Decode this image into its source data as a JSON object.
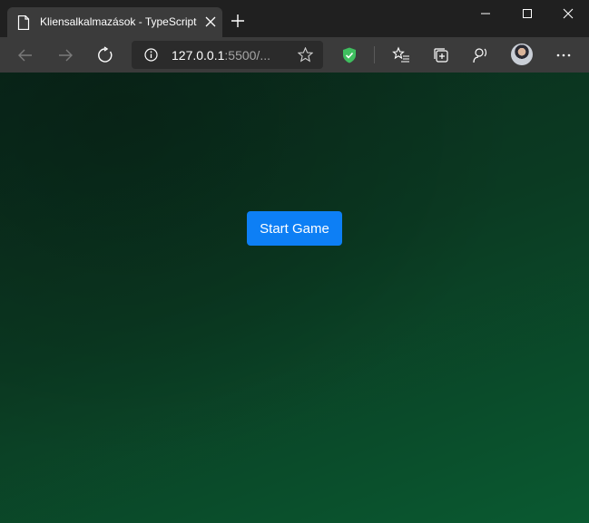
{
  "browser": {
    "tab": {
      "title": "Kliensalkalmazások - TypeScript"
    },
    "address": {
      "host": "127.0.0.1",
      "rest": ":5500/..."
    }
  },
  "icons": {
    "tab": [
      "page-icon",
      "close-icon",
      "plus-icon"
    ],
    "window": [
      "minimize-icon",
      "maximize-icon",
      "close-icon"
    ],
    "toolbar": [
      "back-arrow-icon",
      "forward-arrow-icon",
      "refresh-icon",
      "info-icon",
      "star-icon",
      "shield-check-icon",
      "favorites-icon",
      "collections-icon",
      "read-aloud-icon",
      "profile-avatar",
      "more-dots-icon"
    ]
  },
  "colors": {
    "accent_button": "#0d7ff5",
    "page_gradient": [
      "#0a2a1c",
      "#0a5a31"
    ],
    "shield": "#3fbf5f"
  },
  "game": {
    "start_label": "Start Game"
  }
}
